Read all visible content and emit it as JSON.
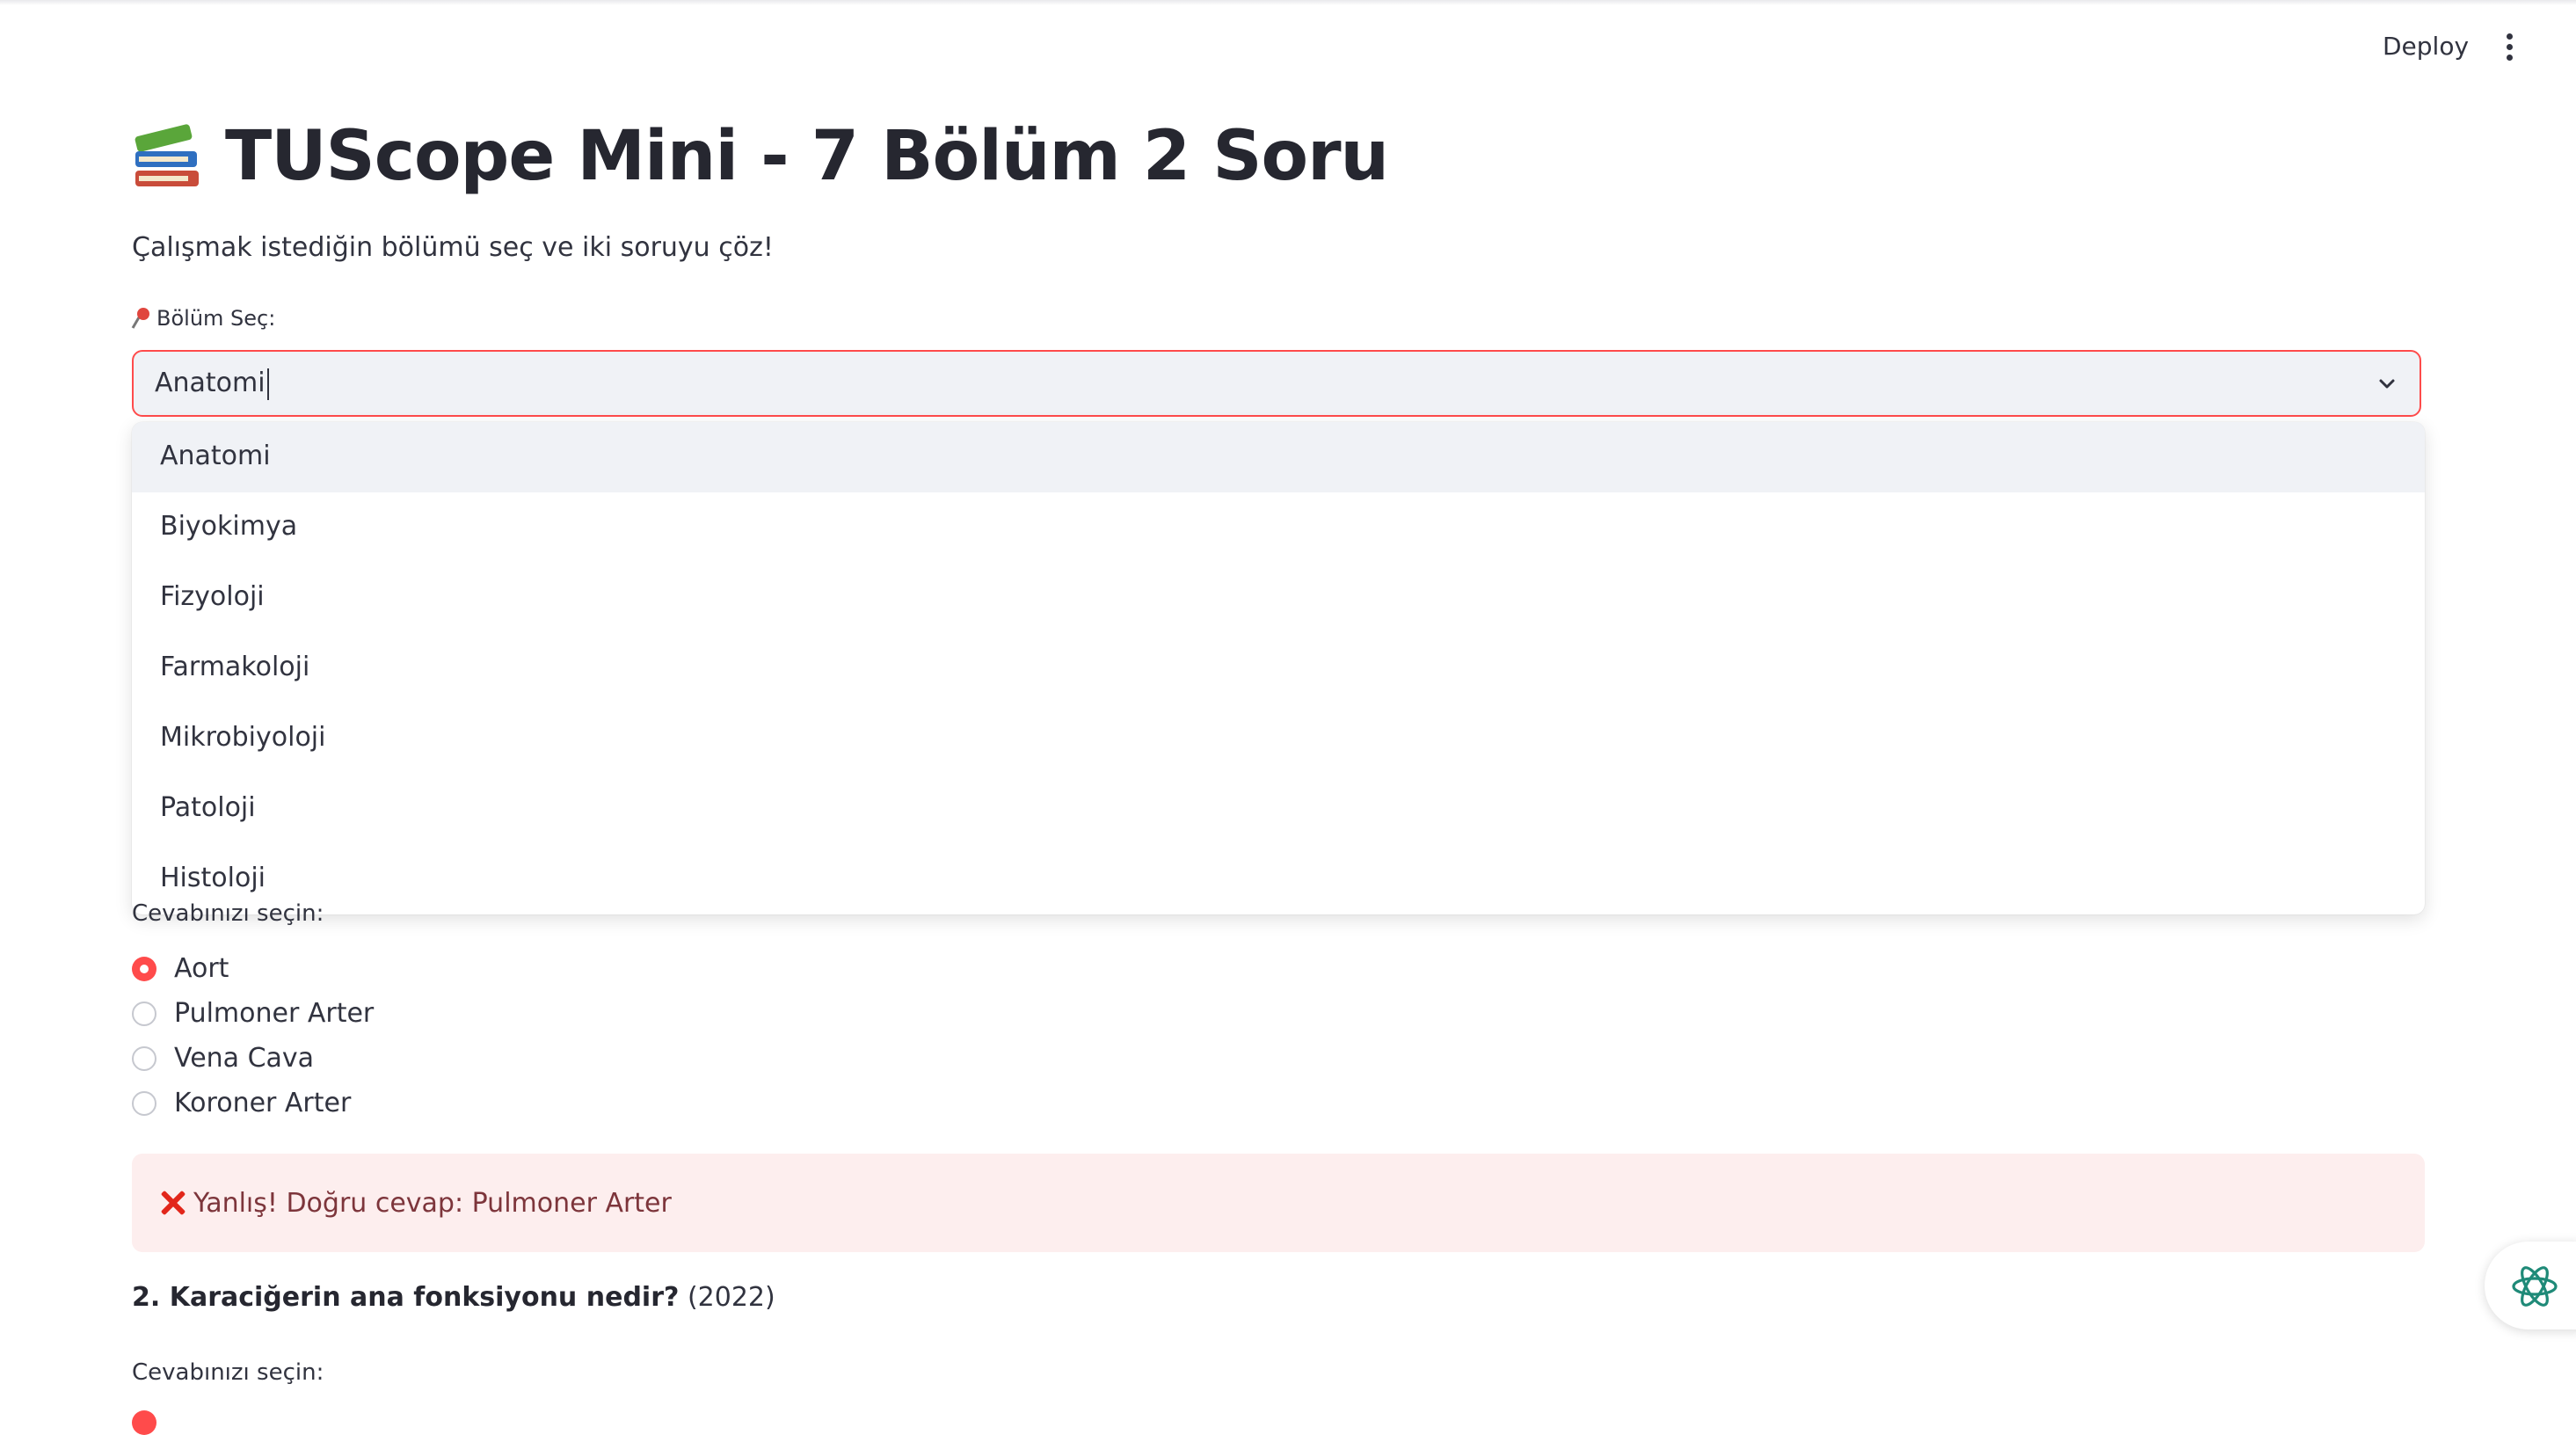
{
  "header": {
    "deploy_label": "Deploy"
  },
  "page": {
    "title": "TUScope Mini - 7 Bölüm 2 Soru",
    "subtitle": "Çalışmak istediğin bölümü seç ve iki soruyu çöz!"
  },
  "section_select": {
    "label": "Bölüm Seç:",
    "value": "Anatomi",
    "options": [
      "Anatomi",
      "Biyokimya",
      "Fizyoloji",
      "Farmakoloji",
      "Mikrobiyoloji",
      "Patoloji",
      "Histoloji"
    ]
  },
  "question1": {
    "answer_prompt": "Cevabınızı seçin:",
    "options": [
      "Aort",
      "Pulmoner Arter",
      "Vena Cava",
      "Koroner Arter"
    ],
    "selected": "Aort",
    "feedback": "Yanlış! Doğru cevap: Pulmoner Arter"
  },
  "question2": {
    "question": "2. Karaciğerin ana fonksiyonu nedir?",
    "year": "(2022)",
    "answer_prompt": "Cevabınızı seçin:"
  },
  "colors": {
    "accent": "#ff4b4b",
    "error_bg": "#fdeeee",
    "error_text": "#7d353b",
    "text": "#31333f"
  }
}
